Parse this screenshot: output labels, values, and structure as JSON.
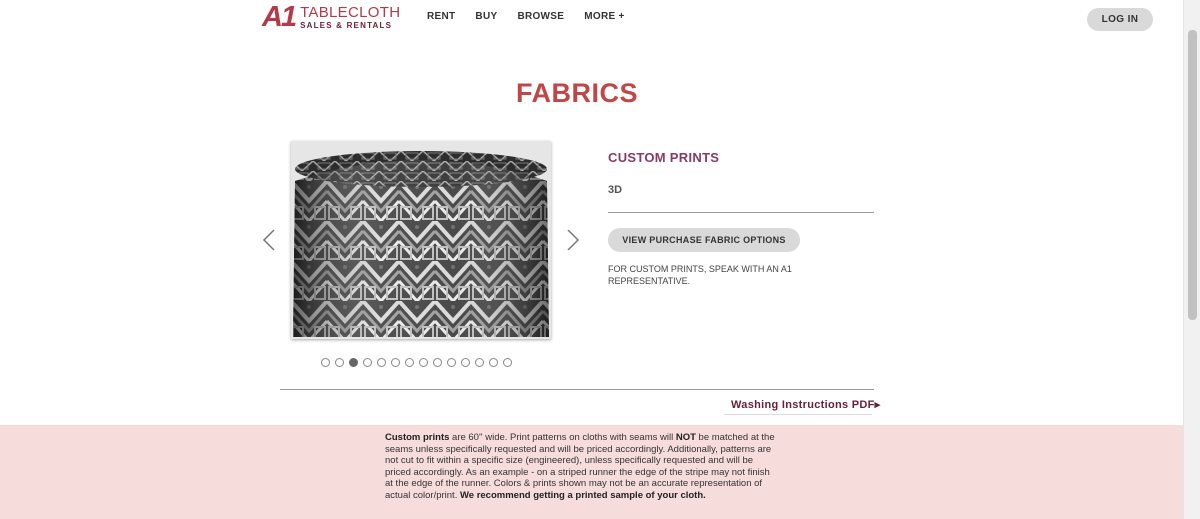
{
  "header": {
    "logo_mark": "A1",
    "logo_main": "TABLECLOTH",
    "logo_sub": "SALES & RENTALS",
    "nav": [
      "RENT",
      "BUY",
      "BROWSE",
      "MORE +"
    ],
    "login_label": "LOG IN"
  },
  "page": {
    "title": "FABRICS"
  },
  "carousel": {
    "slide_count": 14,
    "active_index": 2
  },
  "product": {
    "category": "CUSTOM PRINTS",
    "name": "3D",
    "purchase_button": "VIEW PURCHASE FABRIC OPTIONS",
    "note": "FOR CUSTOM PRINTS, SPEAK WITH AN A1 REPRESENTATIVE."
  },
  "links": {
    "washing": "Washing Instructions PDF▸"
  },
  "notice": {
    "lead_bold": "Custom prints",
    "part1": " are 60'' wide. Print patterns on cloths with seams will ",
    "not_bold": "NOT",
    "part2": " be matched at the seams unless specifically requested and will be priced accordingly. Additionally, patterns are not cut to fit within a specific size (engineered), unless specifically requested and will be priced accordingly. As an example - on a striped runner the edge of the stripe may not finish at the edge of the runner. Colors & prints shown may not be an accurate representation of actual color/print. ",
    "end_bold": "We recommend getting a printed sample of your cloth."
  },
  "colors": {
    "brand_red": "#c14646",
    "plum": "#8a3a64",
    "band_pink": "#f7dcdc"
  }
}
